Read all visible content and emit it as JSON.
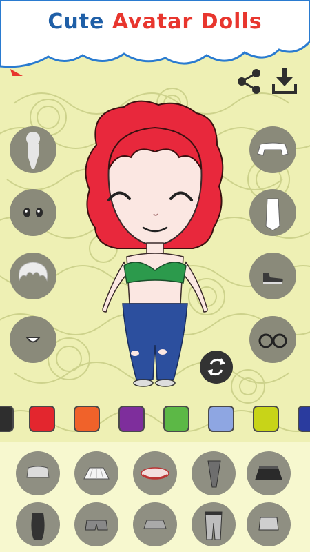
{
  "app": {
    "title_word1": "Cute",
    "title_word2": "Avatar Dolls"
  },
  "icons": {
    "share": "share-icon",
    "download": "download-icon",
    "shuffle": "shuffle-icon"
  },
  "left_tools": [
    "body-tool",
    "eyes-tool",
    "hair-tool",
    "mouth-tool"
  ],
  "right_tools": [
    "top-tool",
    "skirt-tool",
    "shoes-tool",
    "glasses-tool"
  ],
  "colors": {
    "accent_blue": "#1f5fa7",
    "accent_red": "#e8362e",
    "hair": "#e8283c",
    "top": "#2c9a4c",
    "jeans": "#2c4f9e",
    "palette": [
      "#2e2e2e",
      "#e3262e",
      "#f0622a",
      "#7e2e9c",
      "#5cb846",
      "#8ea6e2",
      "#c8d418",
      "#2a3b9e"
    ]
  },
  "drawer_items": [
    "crop-top-item",
    "pleated-skirt-item",
    "red-white-skirt-item",
    "pencil-skirt-item",
    "black-ruffle-skirt-item",
    "dark-dress-item",
    "gray-shorts-item",
    "gray-mini-skirt-item",
    "ripped-jeans-item",
    "gray-skirt-item"
  ]
}
